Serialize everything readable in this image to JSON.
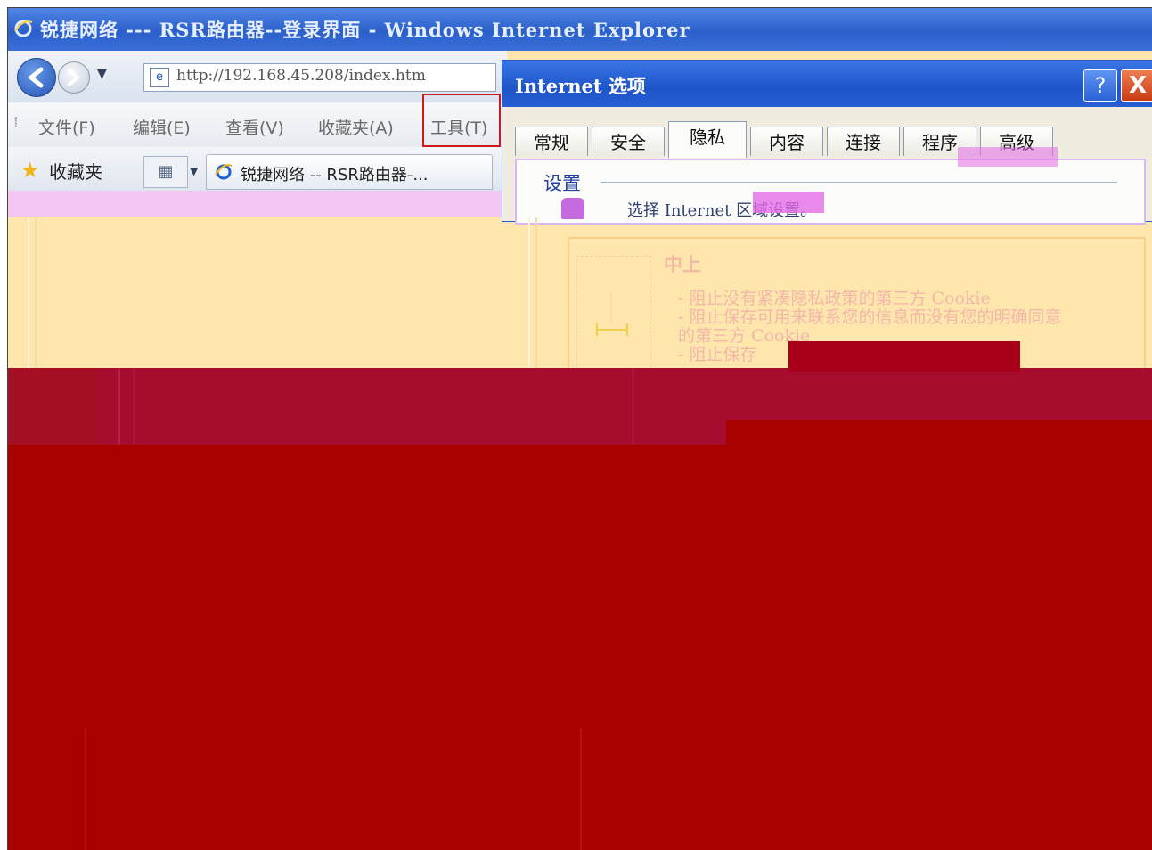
{
  "window": {
    "title": "锐捷网络 --- RSR路由器--登录界面 - Windows Internet Explorer"
  },
  "address_bar": {
    "url": "http://192.168.45.208/index.htm"
  },
  "menu": {
    "items": [
      "文件(F)",
      "编辑(E)",
      "查看(V)",
      "收藏夹(A)",
      "工具(T)"
    ]
  },
  "favorites_bar": {
    "label": "收藏夹",
    "quick_tabs_icon": "quick-tabs-icon",
    "page_tab": "锐捷网络 -- RSR路由器-..."
  },
  "dialog": {
    "title": "Internet 选项",
    "help_glyph": "?",
    "close_glyph": "X",
    "tabs": [
      "常规",
      "安全",
      "隐私",
      "内容",
      "连接",
      "程序",
      "高级"
    ],
    "active_tab": "隐私",
    "section_label": "设置",
    "description": "选择 Internet 区域设置。"
  },
  "privacy_level": {
    "title": "中上",
    "items": [
      "- 阻止没有紧凑隐私政策的第三方 Cookie",
      "- 阻止保存可用来联系您的信息而没有您的明确同意",
      "的第三方 Cookie",
      "- 阻止保存"
    ]
  },
  "colors": {
    "title_bar": "#2b5fc9",
    "content_bg": "#ffe6ad",
    "occlusion_red": "#a90000",
    "highlight_box": "#d01818"
  }
}
